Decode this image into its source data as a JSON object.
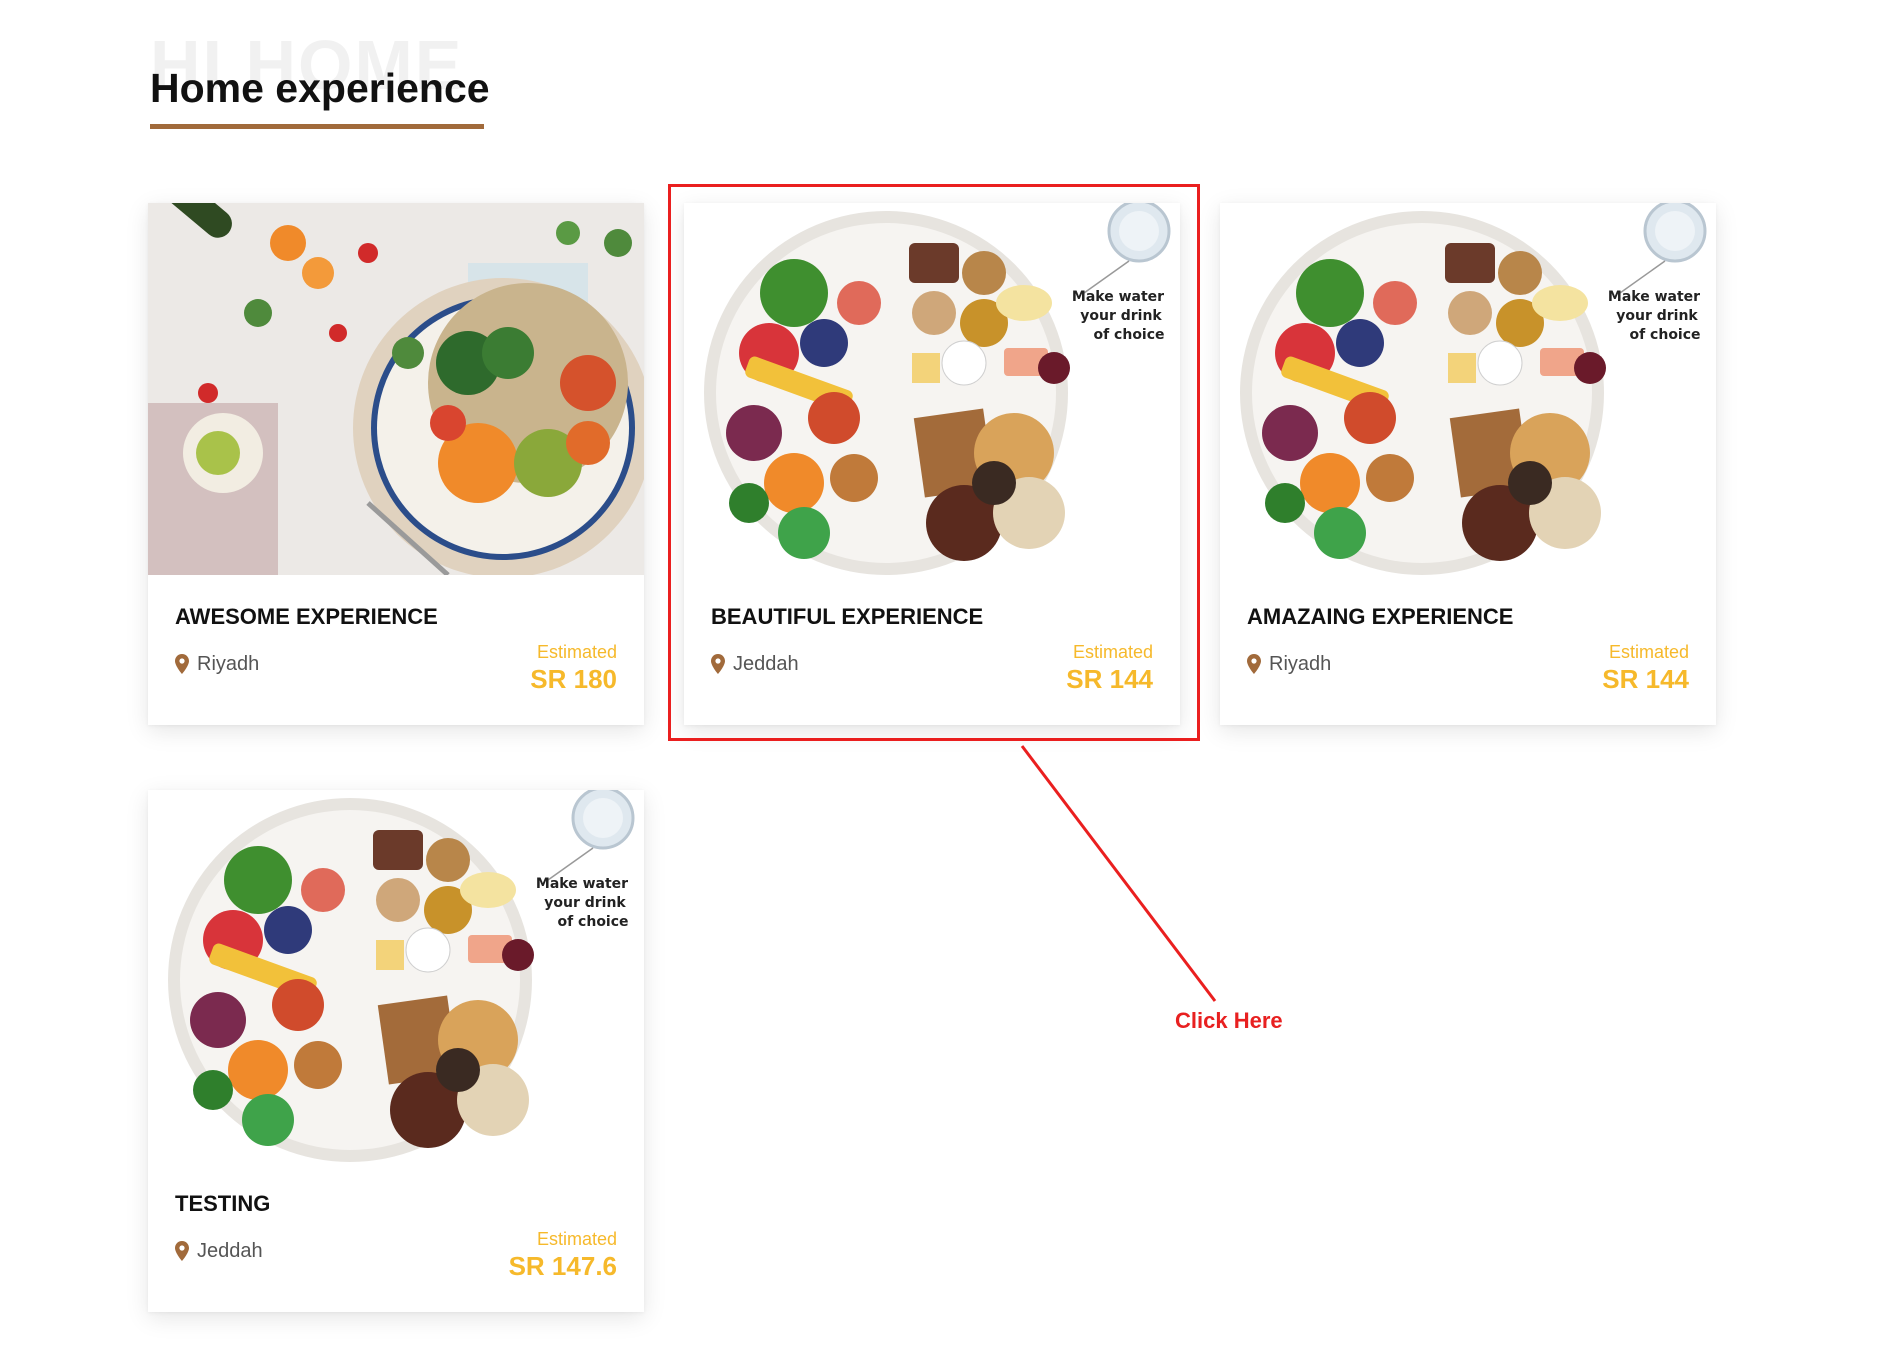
{
  "header": {
    "background_word": "HI HOME",
    "title": "Home experience"
  },
  "cards": [
    {
      "title": "AWESOME EXPERIENCE",
      "location": "Riyadh",
      "estimated_label": "Estimated",
      "price": "SR 180",
      "image": "vegetable-bowl"
    },
    {
      "title": "BEAUTIFUL EXPERIENCE",
      "location": "Jeddah",
      "estimated_label": "Estimated",
      "price": "SR 144",
      "image": "healthy-plate"
    },
    {
      "title": "AMAZAING EXPERIENCE",
      "location": "Riyadh",
      "estimated_label": "Estimated",
      "price": "SR 144",
      "image": "healthy-plate"
    },
    {
      "title": "TESTING",
      "location": "Jeddah",
      "estimated_label": "Estimated",
      "price": "SR 147.6",
      "image": "healthy-plate"
    }
  ],
  "plate_caption": [
    "Make water",
    "your drink",
    "of choice"
  ],
  "annotation": {
    "text": "Click Here",
    "color": "#e82020"
  },
  "colors": {
    "price": "#f6b92b",
    "underline": "#a16a3b",
    "pin": "#a16a3b"
  }
}
